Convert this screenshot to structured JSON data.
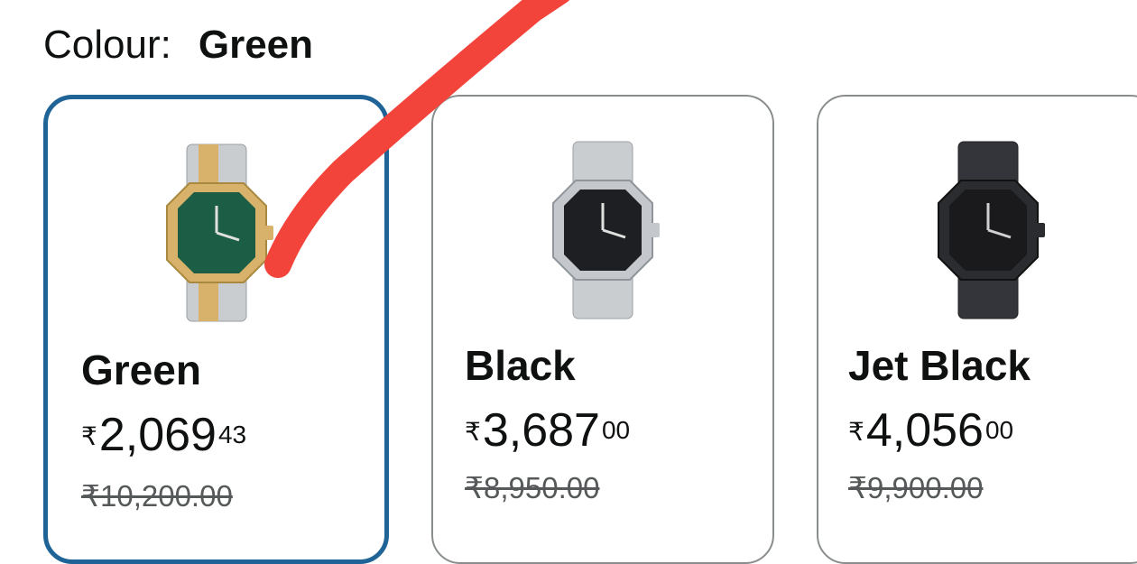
{
  "header": {
    "label": "Colour:",
    "selected": "Green"
  },
  "variants": [
    {
      "name": "Green",
      "symbol": "₹",
      "whole": "2,069",
      "fraction": "43",
      "mrp": "₹10,200.00",
      "dial_color": "#1b5e45",
      "case_color": "#d8b26a",
      "strap_color": "#c9cdd0",
      "selected": true
    },
    {
      "name": "Black",
      "symbol": "₹",
      "whole": "3,687",
      "fraction": "00",
      "mrp": "₹8,950.00",
      "dial_color": "#1e1f22",
      "case_color": "#c4c8cc",
      "strap_color": "#c9cdd0",
      "selected": false
    },
    {
      "name": "Jet Black",
      "symbol": "₹",
      "whole": "4,056",
      "fraction": "00",
      "mrp": "₹9,900.00",
      "dial_color": "#1a1a1c",
      "case_color": "#2b2c2f",
      "strap_color": "#33353a",
      "selected": false
    }
  ],
  "colors": {
    "selected_border": "#1f6397",
    "card_border": "#8a8d8d",
    "annotation_stroke": "#f2443a"
  }
}
